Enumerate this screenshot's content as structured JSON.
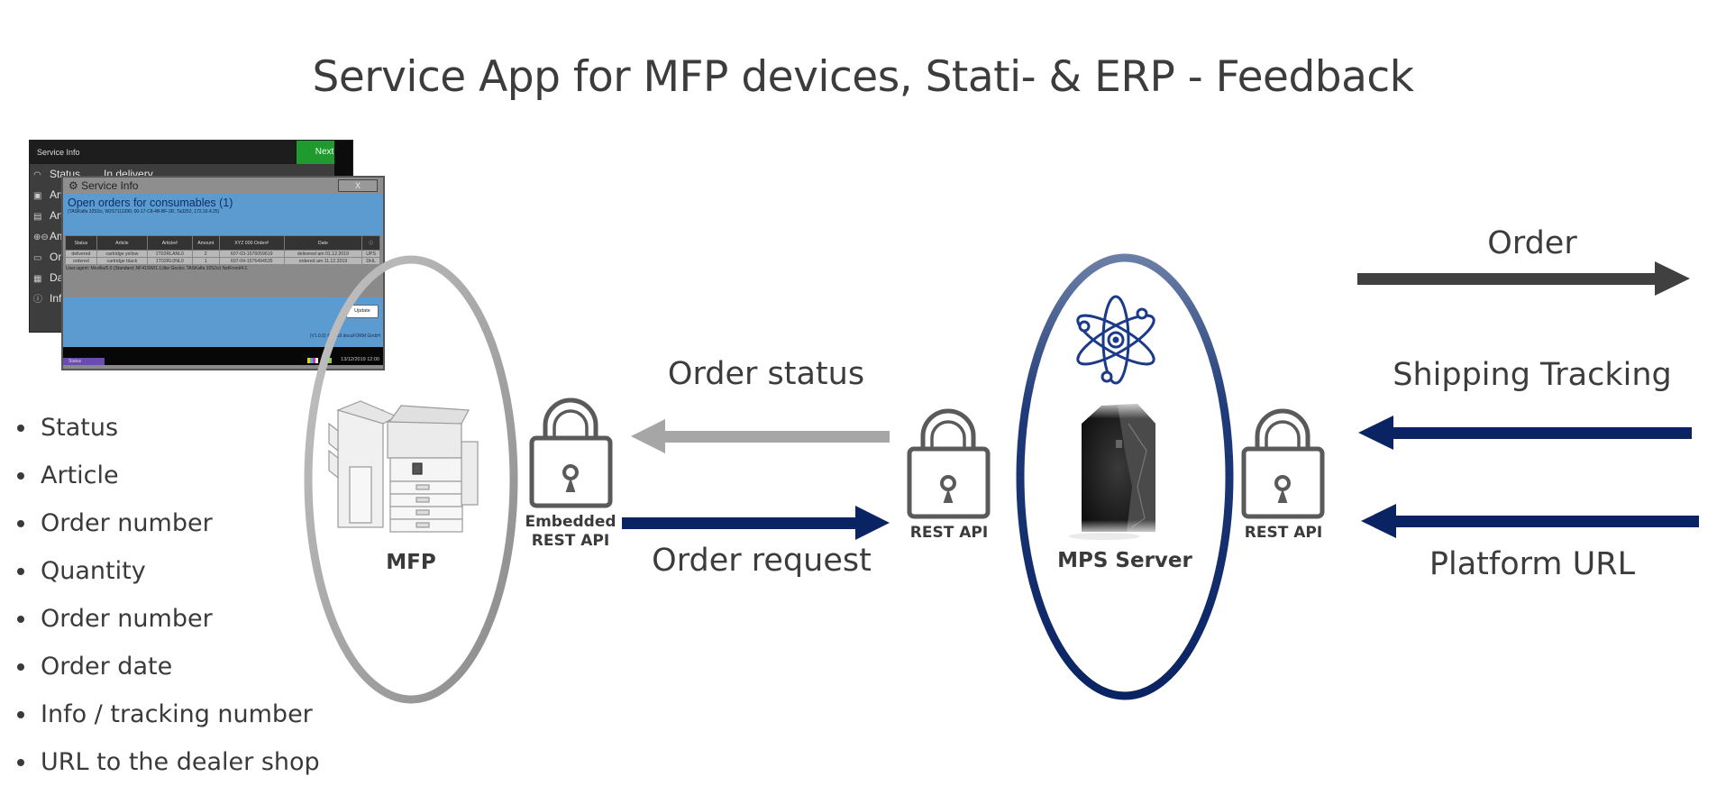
{
  "title": "Service App for MFP devices, Stati- & ERP - Feedback",
  "colors": {
    "navy": "#0a2463",
    "gray_arrow": "#a6a6a6",
    "dark_arrow": "#404040",
    "lock": "#5a5a5a",
    "mfp_ellipse": "#a8a8a8",
    "atom": "#1c3a8a"
  },
  "bullets": [
    "Status",
    "Article",
    "Order number",
    "Quantity",
    "Order number",
    "Order date",
    "Info / tracking number",
    "URL to the dealer shop"
  ],
  "inset": {
    "back_panel": {
      "header": "Service Info",
      "next_button": "Next",
      "rows": [
        {
          "icon": "gauge-icon",
          "label": "Status",
          "value": "In delivery"
        },
        {
          "icon": "box-icon",
          "label": "Arti"
        },
        {
          "icon": "barcode-icon",
          "label": "Arti"
        },
        {
          "icon": "amount-icon",
          "label": "Am"
        },
        {
          "icon": "order-icon",
          "label": "Ord"
        },
        {
          "icon": "calendar-icon",
          "label": "Dat"
        },
        {
          "icon": "info-icon",
          "label": "Info"
        }
      ]
    },
    "dialog": {
      "title": "Service Info",
      "close_label": "X",
      "heading": "Open orders for consumables (1)",
      "device_info": "(TASKalfa 3252ci, W2S7111390, 00-17-C8-4B-BF-3D, Ta3252, 172.16.4.25)",
      "columns": [
        "Status",
        "Article",
        "Article#",
        "Amount",
        "XYZ 000 Order#",
        "Date",
        "ⓘ"
      ],
      "rows": [
        [
          "delivered",
          "cartridge yellow",
          "1T02RLANL0",
          "2",
          "607-03-1576059619",
          "delivered am 01.12.2019",
          "UPS"
        ],
        [
          "ordered",
          "cartridge black",
          "1T02RL0NL0",
          "1",
          "607-04-1576494535",
          "ordered am 11.12.2019",
          "DHL"
        ]
      ],
      "user_agent": "User-agent: Mozilla/5.0 (Standard; NF41SW/1.1;like Gecko; TASKalfa 3252ci) NetFront/4.1",
      "update_button": "Update",
      "copyright": "(V1.0.0) © 2019 docuFORM GmbH",
      "status_tab": "Status",
      "datetime": "13/12/2019  12:00"
    }
  },
  "nodes": {
    "mfp": {
      "label": "MFP",
      "icon": "printer-icon"
    },
    "server": {
      "label": "MPS Server",
      "icon": "server-icon",
      "badge_icon": "atom-icon"
    }
  },
  "apis": {
    "embedded": {
      "line1": "Embedded",
      "line2": "REST API"
    },
    "server_left": "REST API",
    "server_right": "REST API"
  },
  "flows": {
    "order_status": "Order status",
    "order_request": "Order request",
    "order": "Order",
    "shipping_tracking": "Shipping Tracking",
    "platform_url": "Platform URL"
  }
}
